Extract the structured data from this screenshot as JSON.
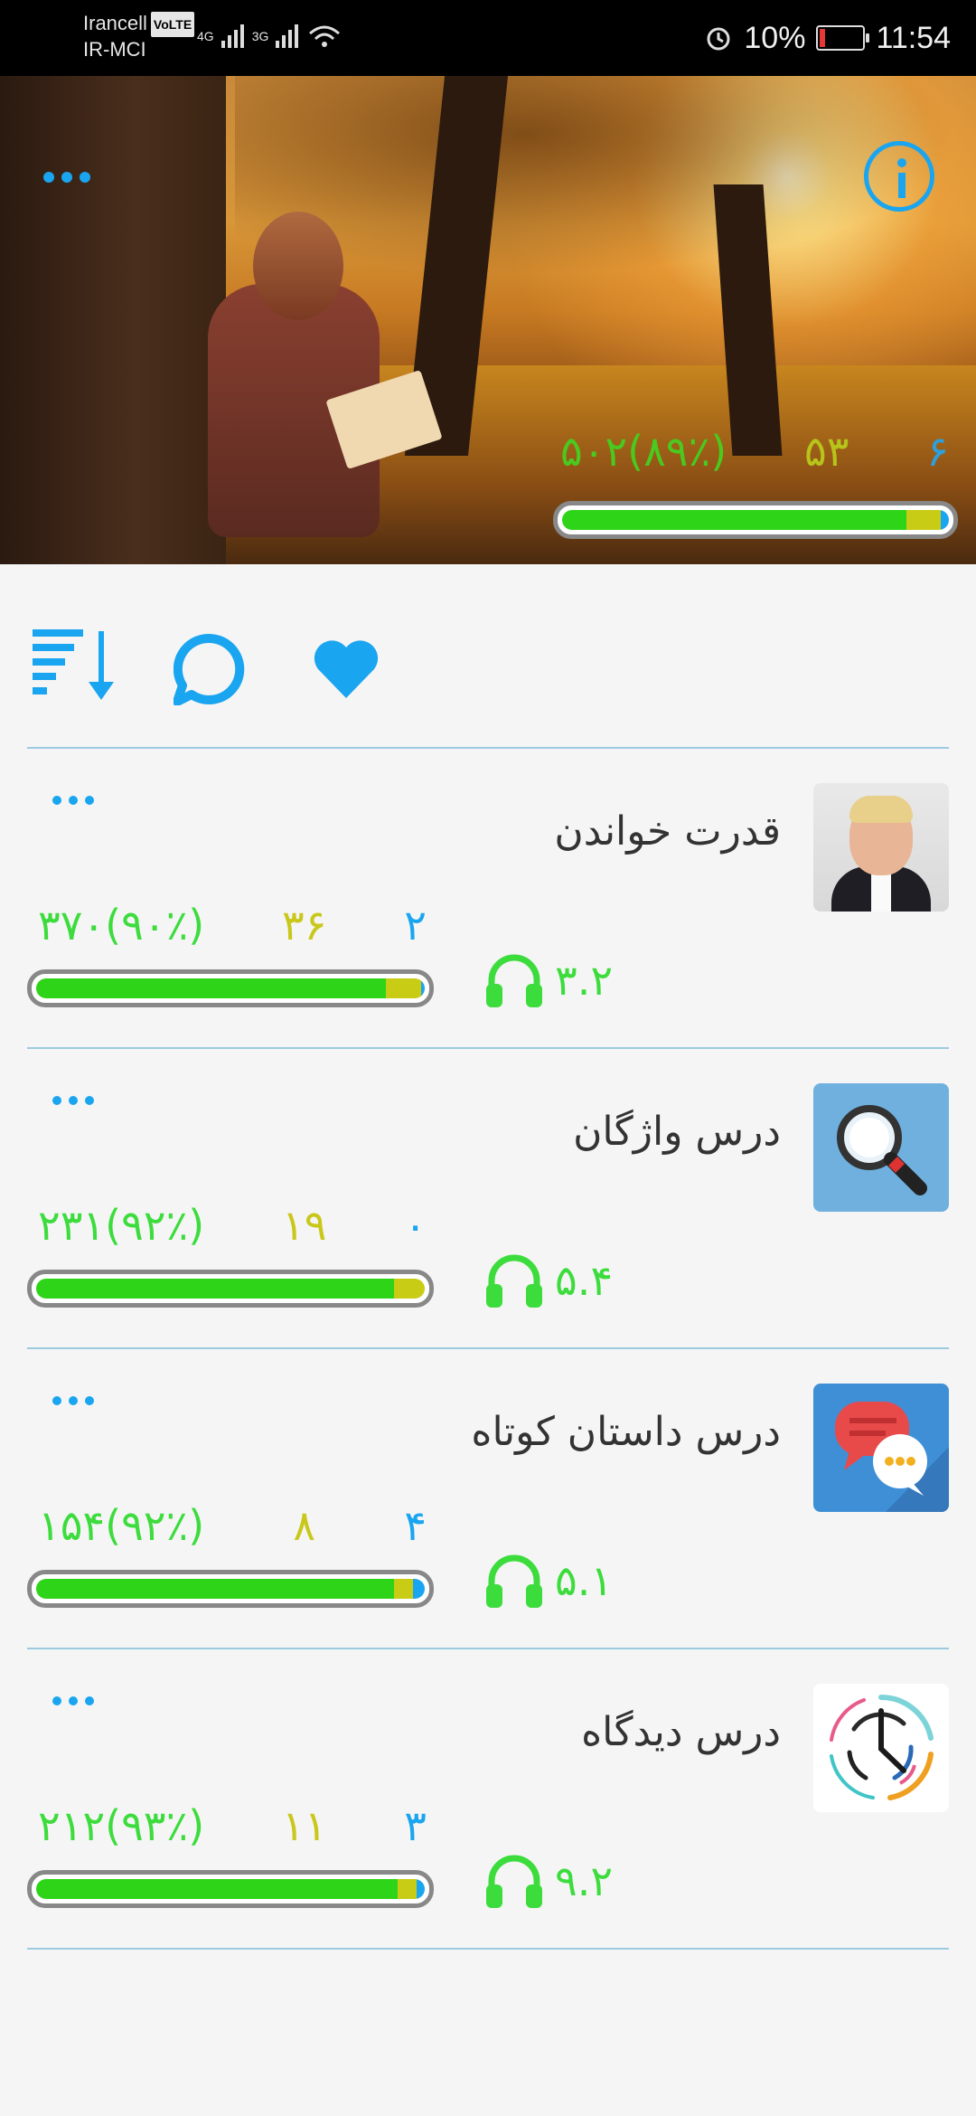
{
  "status_bar": {
    "carrier_1": "Irancell",
    "volte": "VoLTE",
    "carrier_2": "IR-MCI",
    "net_1": "4G",
    "net_2": "3G",
    "battery_percent": "10%",
    "time": "11:54",
    "icons": [
      "signal-icon",
      "wifi-icon",
      "alarm-icon",
      "battery-icon"
    ]
  },
  "hero": {
    "stat_green": "۵۰۲(۸۹٪)",
    "stat_yellow": "۵۳",
    "stat_blue": "۶",
    "progress": {
      "green": 0.89,
      "yellow": 0.09,
      "blue": 0.02
    },
    "icons": [
      "more-icon",
      "info-icon"
    ]
  },
  "toolbar": {
    "icons": [
      "sort-icon",
      "comment-icon",
      "heart-icon"
    ]
  },
  "colors": {
    "accent_blue": "#1aa5f0",
    "green": "#2ed418",
    "yellow": "#c8cc14",
    "divider": "#9ccbe0"
  },
  "lessons": [
    {
      "title": "قدرت خواندن",
      "stat_green": "۳۷۰(۹۰٪)",
      "stat_yellow": "۳۶",
      "stat_blue": "۲",
      "rating": "۳.۲",
      "progress": {
        "green": 0.9,
        "yellow": 0.09,
        "blue": 0.01
      },
      "thumbnail": "author-photo"
    },
    {
      "title": "درس واژگان",
      "stat_green": "۲۳۱(۹۲٪)",
      "stat_yellow": "۱۹",
      "stat_blue": "۰",
      "rating": "۵.۴",
      "progress": {
        "green": 0.92,
        "yellow": 0.08,
        "blue": 0.0
      },
      "thumbnail": "magnifier-icon"
    },
    {
      "title": "درس داستان کوتاه",
      "stat_green": "۱۵۴(۹۲٪)",
      "stat_yellow": "۸",
      "stat_blue": "۴",
      "rating": "۵.۱",
      "progress": {
        "green": 0.92,
        "yellow": 0.05,
        "blue": 0.03
      },
      "thumbnail": "chat-bubbles-icon"
    },
    {
      "title": "درس دیدگاه",
      "stat_green": "۲۱۲(۹۳٪)",
      "stat_yellow": "۱۱",
      "stat_blue": "۳",
      "rating": "۹.۲",
      "progress": {
        "green": 0.93,
        "yellow": 0.05,
        "blue": 0.02
      },
      "thumbnail": "clock-icon"
    }
  ]
}
